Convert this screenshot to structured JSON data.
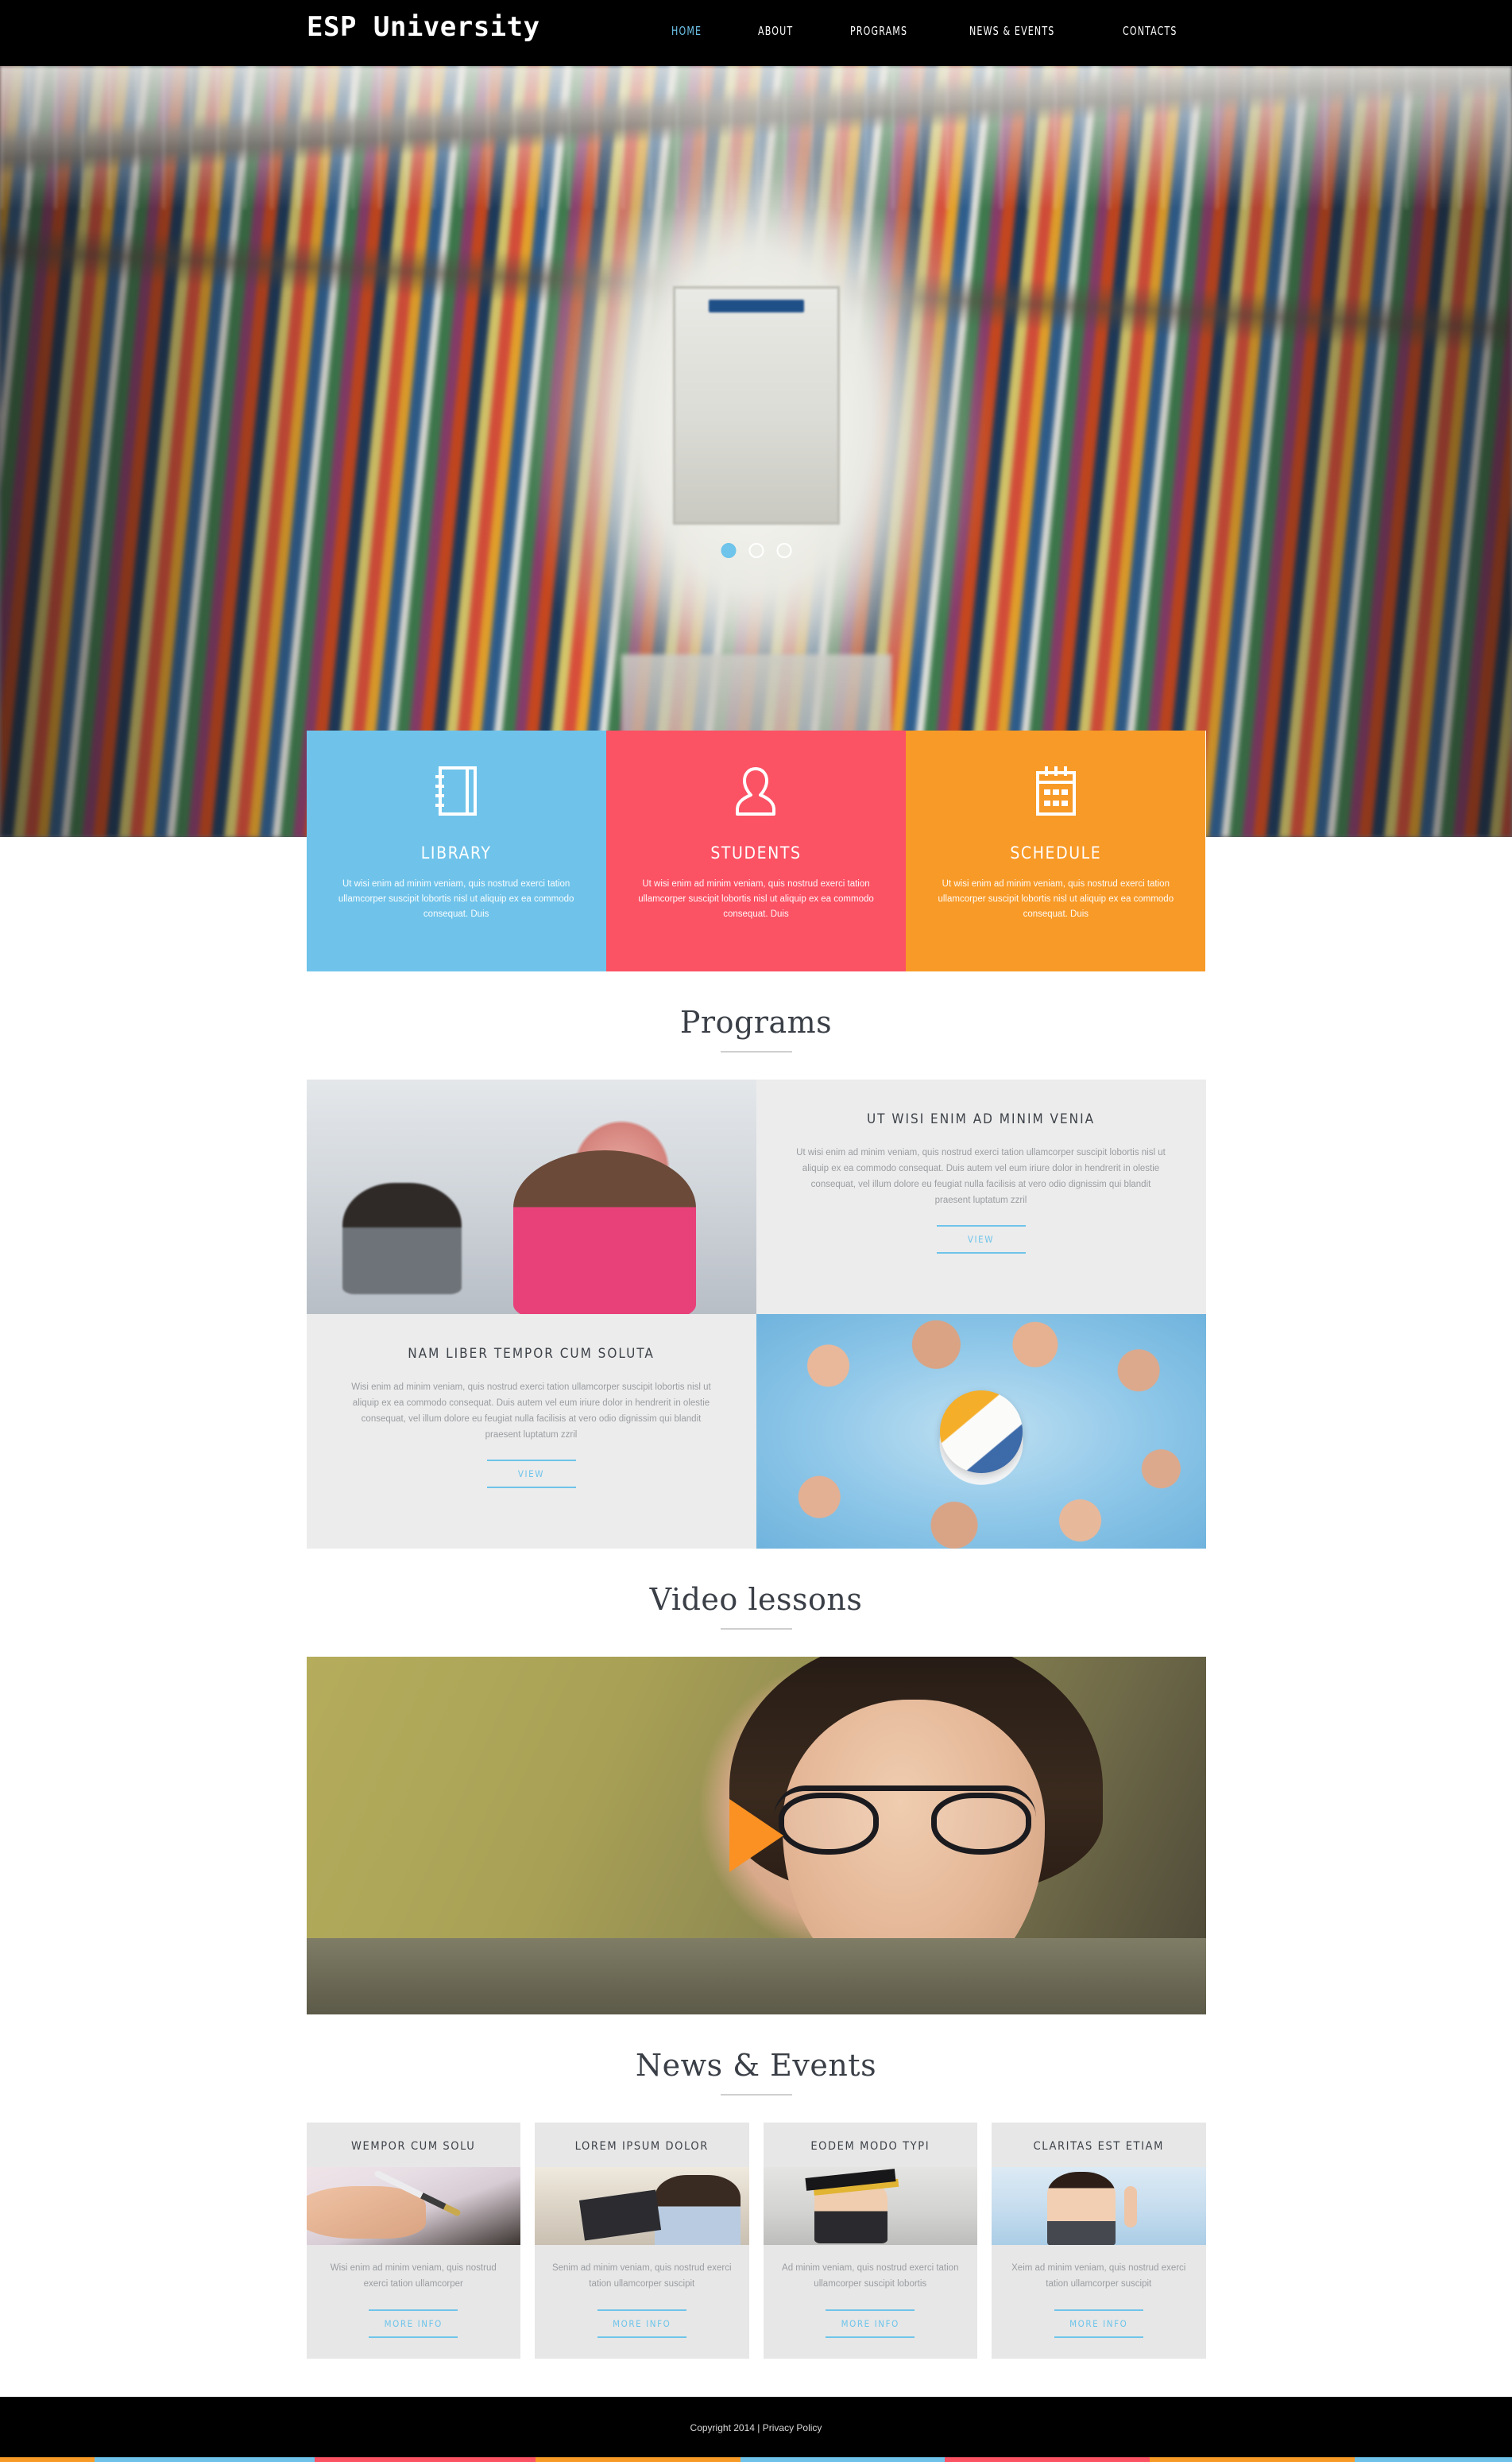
{
  "header": {
    "logo": "ESP University",
    "nav": [
      {
        "label": "HOME",
        "active": true
      },
      {
        "label": "ABOUT",
        "active": false
      },
      {
        "label": "PROGRAMS",
        "active": false
      },
      {
        "label": "NEWS & EVENTS",
        "active": false
      },
      {
        "label": "CONTACTS",
        "active": false
      }
    ]
  },
  "hero": {
    "slides_total": 3,
    "active_slide": 1
  },
  "features": [
    {
      "title": "LIBRARY",
      "icon": "notebook-icon",
      "color": "#6fc3ea",
      "text": "Ut wisi enim ad minim veniam, quis nostrud exerci tation ullamcorper suscipit lobortis nisl ut aliquip ex ea commodo consequat. Duis"
    },
    {
      "title": "STUDENTS",
      "icon": "person-icon",
      "color": "#fb5264",
      "text": "Ut wisi enim ad minim veniam, quis nostrud exerci tation ullamcorper suscipit lobortis nisl ut aliquip ex ea commodo consequat. Duis"
    },
    {
      "title": "SCHEDULE",
      "icon": "calendar-icon",
      "color": "#f89a27",
      "text": "Ut wisi enim ad minim veniam, quis nostrud exerci tation ullamcorper suscipit lobortis nisl ut aliquip ex ea commodo consequat. Duis"
    }
  ],
  "programs": {
    "heading": "Programs",
    "items": [
      {
        "title": "UT WISI ENIM AD MINIM VENIA",
        "body": "Ut wisi enim ad minim veniam, quis nostrud exerci tation ullamcorper suscipit lobortis nisl ut aliquip ex ea commodo consequat. Duis autem vel eum iriure dolor in hendrerit in olestie consequat, vel illum dolore eu feugiat nulla facilisis at vero odio dignissim qui blandit praesent luptatum zzril",
        "button": "VIEW",
        "image": "students-studying-photo"
      },
      {
        "title": "NAM LIBER TEMPOR CUM SOLUTA",
        "body": "Wisi enim ad minim veniam, quis nostrud exerci tation ullamcorper suscipit lobortis nisl ut aliquip ex ea commodo consequat. Duis autem vel eum iriure dolor in hendrerit in olestie consequat, vel illum dolore eu feugiat nulla facilisis at vero odio dignissim qui blandit praesent luptatum zzril",
        "button": "VIEW",
        "image": "volleyball-team-photo"
      }
    ]
  },
  "video": {
    "heading": "Video lessons",
    "play_icon": "play-icon",
    "accent": "#fb9122"
  },
  "news": {
    "heading": "News & Events",
    "cards": [
      {
        "title": "WEMPOR CUM SOLU",
        "body": "Wisi enim ad minim veniam, quis nostrud exerci tation ullamcorper",
        "button": "MORE INFO",
        "image": "hand-writing-photo"
      },
      {
        "title": "LOREM IPSUM DOLOR",
        "body": "Senim ad minim veniam, quis nostrud exerci tation ullamcorper suscipit",
        "button": "MORE INFO",
        "image": "meeting-photo"
      },
      {
        "title": "EODEM MODO TYPI",
        "body": "Ad minim veniam, quis nostrud exerci tation ullamcorper suscipit lobortis",
        "button": "MORE INFO",
        "image": "graduate-boy-photo"
      },
      {
        "title": "CLARITAS EST ETIAM",
        "body": "Xeim ad minim veniam, quis nostrud exerci tation ullamcorper suscipit",
        "button": "MORE INFO",
        "image": "pointing-girl-photo"
      }
    ]
  },
  "footer": {
    "copyright": "Copyright 2014",
    "separator": "|",
    "privacy": "Privacy Policy",
    "strip_colors": [
      "#f89a27",
      "#6fc3ea",
      "#fb5264",
      "#f89a27",
      "#6fc3ea",
      "#fb5264",
      "#f89a27",
      "#6fc3ea"
    ]
  }
}
